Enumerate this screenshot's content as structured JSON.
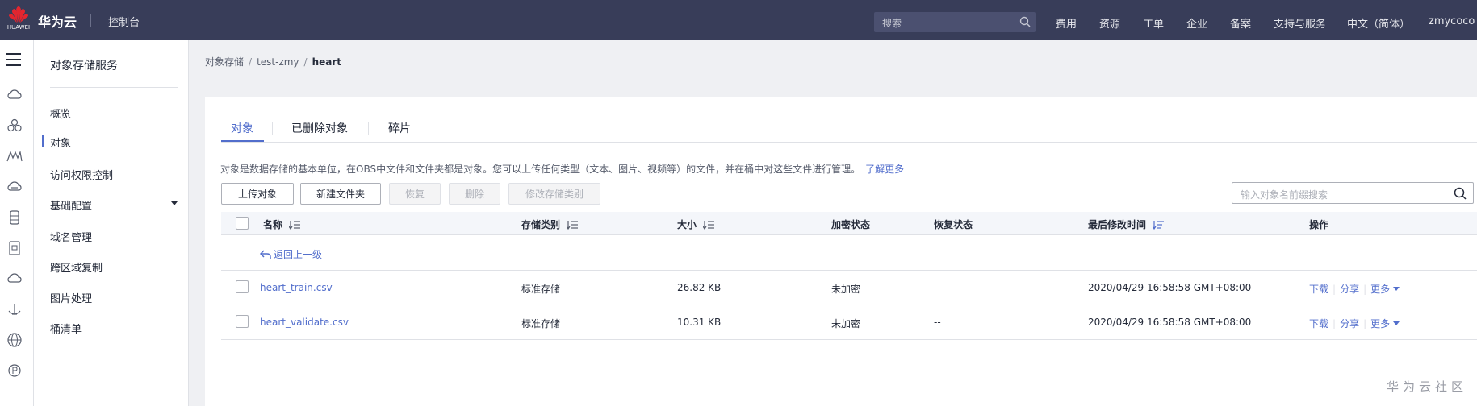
{
  "topbar": {
    "logo_text": "HUAWEI",
    "brand": "华为云",
    "console": "控制台",
    "search_placeholder": "搜索",
    "nav": [
      "费用",
      "资源",
      "工单",
      "企业",
      "备案",
      "支持与服务",
      "中文（简体）",
      "zmycoco"
    ]
  },
  "sidebar": {
    "title": "对象存储服务",
    "items": [
      {
        "label": "概览"
      },
      {
        "label": "对象"
      },
      {
        "label": "访问权限控制"
      },
      {
        "label": "基础配置"
      },
      {
        "label": "域名管理"
      },
      {
        "label": "跨区域复制"
      },
      {
        "label": "图片处理"
      },
      {
        "label": "桶清单"
      }
    ]
  },
  "breadcrumb": [
    "对象存储",
    "test-zmy",
    "heart"
  ],
  "tabs": [
    "对象",
    "已删除对象",
    "碎片"
  ],
  "description": "对象是数据存储的基本单位，在OBS中文件和文件夹都是对象。您可以上传任何类型（文本、图片、视频等）的文件，并在桶中对这些文件进行管理。",
  "learn_more": "了解更多",
  "buttons": {
    "upload": "上传对象",
    "new_folder": "新建文件夹",
    "restore": "恢复",
    "delete": "删除",
    "change_class": "修改存储类别"
  },
  "search_placeholder": "输入对象名前缀搜索",
  "table": {
    "columns": [
      "名称",
      "存储类别",
      "大小",
      "加密状态",
      "恢复状态",
      "最后修改时间",
      "操作"
    ],
    "back_label": "返回上一级",
    "rows": [
      {
        "name": "heart_train.csv",
        "storage_class": "标准存储",
        "size": "26.82 KB",
        "encryption": "未加密",
        "restore": "--",
        "modified": "2020/04/29 16:58:58 GMT+08:00"
      },
      {
        "name": "heart_validate.csv",
        "storage_class": "标准存储",
        "size": "10.31 KB",
        "encryption": "未加密",
        "restore": "--",
        "modified": "2020/04/29 16:58:58 GMT+08:00"
      }
    ],
    "ops": {
      "download": "下载",
      "share": "分享",
      "more": "更多"
    }
  },
  "watermark": "华为云社区",
  "colors": {
    "topbar": "#383d59",
    "accent": "#526ecc"
  }
}
